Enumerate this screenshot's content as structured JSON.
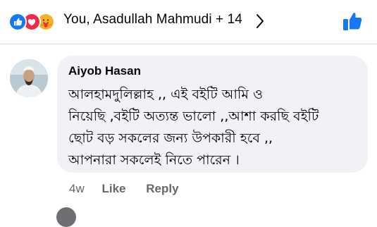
{
  "colors": {
    "like_blue": "#1877f2",
    "love_red": "#f02849",
    "care_yellow": "#f7b125",
    "bubble_bg": "#f0f2f5",
    "secondary_text": "#65676b"
  },
  "reactions": {
    "icons": [
      "like-icon",
      "love-icon",
      "care-icon"
    ],
    "summary": "You, Asadullah Mahmudi + 14"
  },
  "comment": {
    "author": "Aiyob Hasan",
    "lines": [
      "আলহামদুলিল্লাহ ,, এই বইটি আমি ও",
      "নিয়েছি ,বইটি অত্যন্ত ভালো ,,আশা করছি বইটি",
      "ছোট বড় সকলের জন্য উপকারী হবে ,,",
      "আপনারা সকলেই নিতে পারেন ।"
    ],
    "time": "4w",
    "like_label": "Like",
    "reply_label": "Reply"
  }
}
